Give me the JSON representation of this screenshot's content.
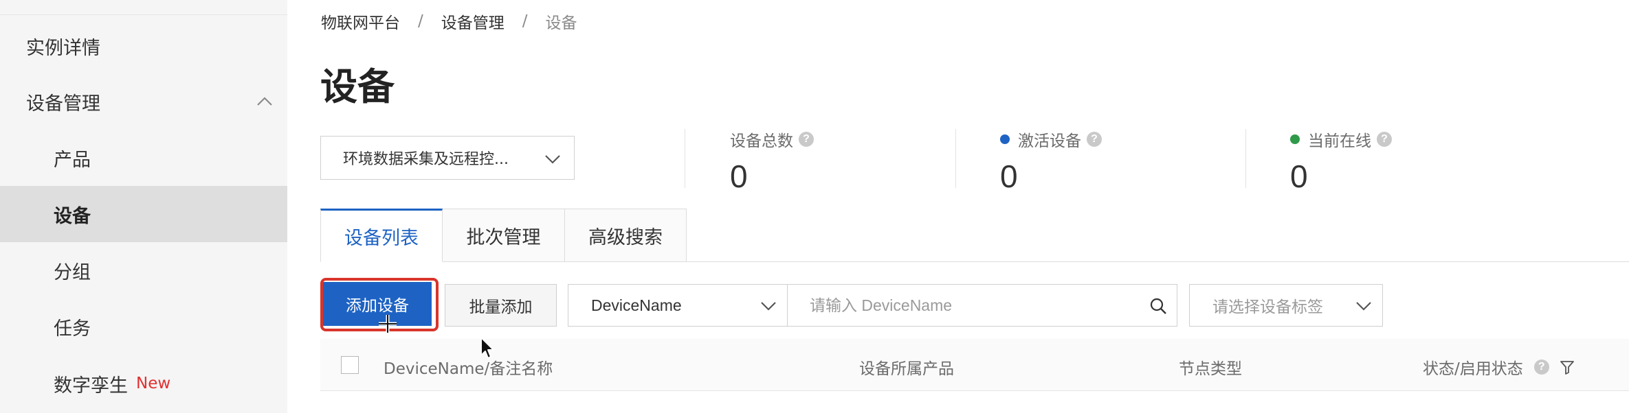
{
  "sidebar": {
    "items": [
      {
        "label": "实例详情"
      },
      {
        "label": "设备管理"
      },
      {
        "label": "产品"
      },
      {
        "label": "设备"
      },
      {
        "label": "分组"
      },
      {
        "label": "任务"
      },
      {
        "label": "数字孪生",
        "badge": "New"
      }
    ]
  },
  "breadcrumb": [
    "物联网平台",
    "设备管理",
    "设备"
  ],
  "breadcrumb_separator": "/",
  "page": {
    "title": "设备"
  },
  "product_select": {
    "value": "环境数据采集及远程控..."
  },
  "stats": [
    {
      "label": "设备总数",
      "value": "0"
    },
    {
      "label": "激活设备",
      "value": "0",
      "dot_color": "#1e63c4"
    },
    {
      "label": "当前在线",
      "value": "0",
      "dot_color": "#2e9a4a"
    }
  ],
  "help_glyph": "?",
  "tabs": [
    {
      "label": "设备列表",
      "active": true
    },
    {
      "label": "批次管理"
    },
    {
      "label": "高级搜索"
    }
  ],
  "toolbar": {
    "add_label": "添加设备",
    "batch_add_label": "批量添加",
    "field_select_value": "DeviceName",
    "search_placeholder": "请输入 DeviceName",
    "tag_placeholder": "请选择设备标签"
  },
  "table": {
    "columns": [
      "DeviceName/备注名称",
      "设备所属产品",
      "节点类型",
      "状态/启用状态"
    ]
  },
  "colors": {
    "accent": "#1e63c4",
    "highlight": "#d9342b",
    "new_badge": "#e0302f"
  }
}
